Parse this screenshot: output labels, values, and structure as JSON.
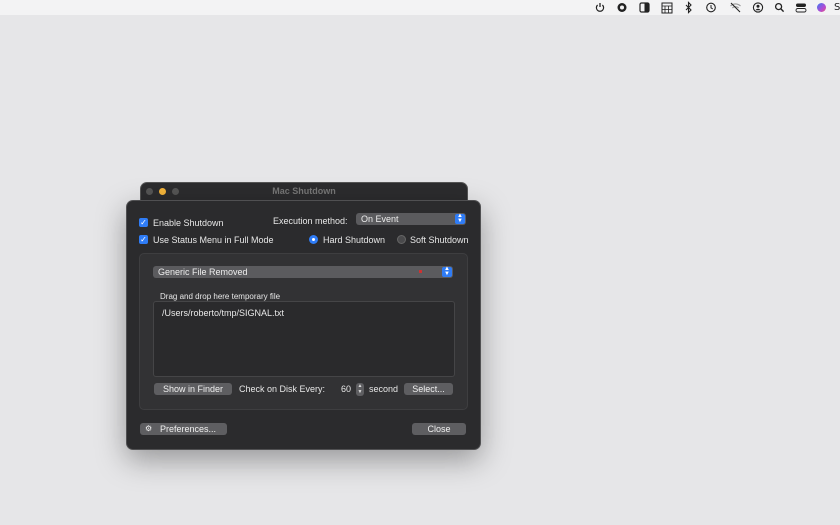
{
  "menubar": {
    "icons": [
      "power-icon",
      "gear-icon",
      "appearance-icon",
      "calendar-icon",
      "bluetooth-icon",
      "time-machine-icon",
      "wifi-off-icon",
      "user-icon",
      "search-icon",
      "control-center-icon",
      "siri-icon"
    ],
    "clipped_text": "S"
  },
  "back_window": {
    "title": "Mac Shutdown"
  },
  "window": {
    "enable_shutdown": {
      "label": "Enable Shutdown",
      "checked": true
    },
    "use_status_menu": {
      "label": "Use Status Menu in Full Mode",
      "checked": true
    },
    "execution_method": {
      "label": "Execution method:",
      "value": "On Event"
    },
    "shutdown_type": {
      "hard": "Hard Shutdown",
      "soft": "Soft Shutdown",
      "selected": "hard"
    },
    "event_type": {
      "value": "Generic File Removed"
    },
    "drop_label": "Drag and drop here temporary file",
    "file_path": "/Users/roberto/tmp/SIGNAL.txt",
    "show_in_finder": "Show in Finder",
    "check_label": "Check on Disk Every:",
    "interval_value": "60",
    "interval_unit": "second",
    "select_button": "Select...",
    "preferences_button": "Preferences...",
    "close_button": "Close"
  },
  "colors": {
    "accent": "#2f7cf6",
    "window_bg": "#2b2b2d",
    "desktop_bg": "#e6e6e8",
    "traffic_close": "#4a4a4c",
    "traffic_min": "#f5b53a"
  }
}
